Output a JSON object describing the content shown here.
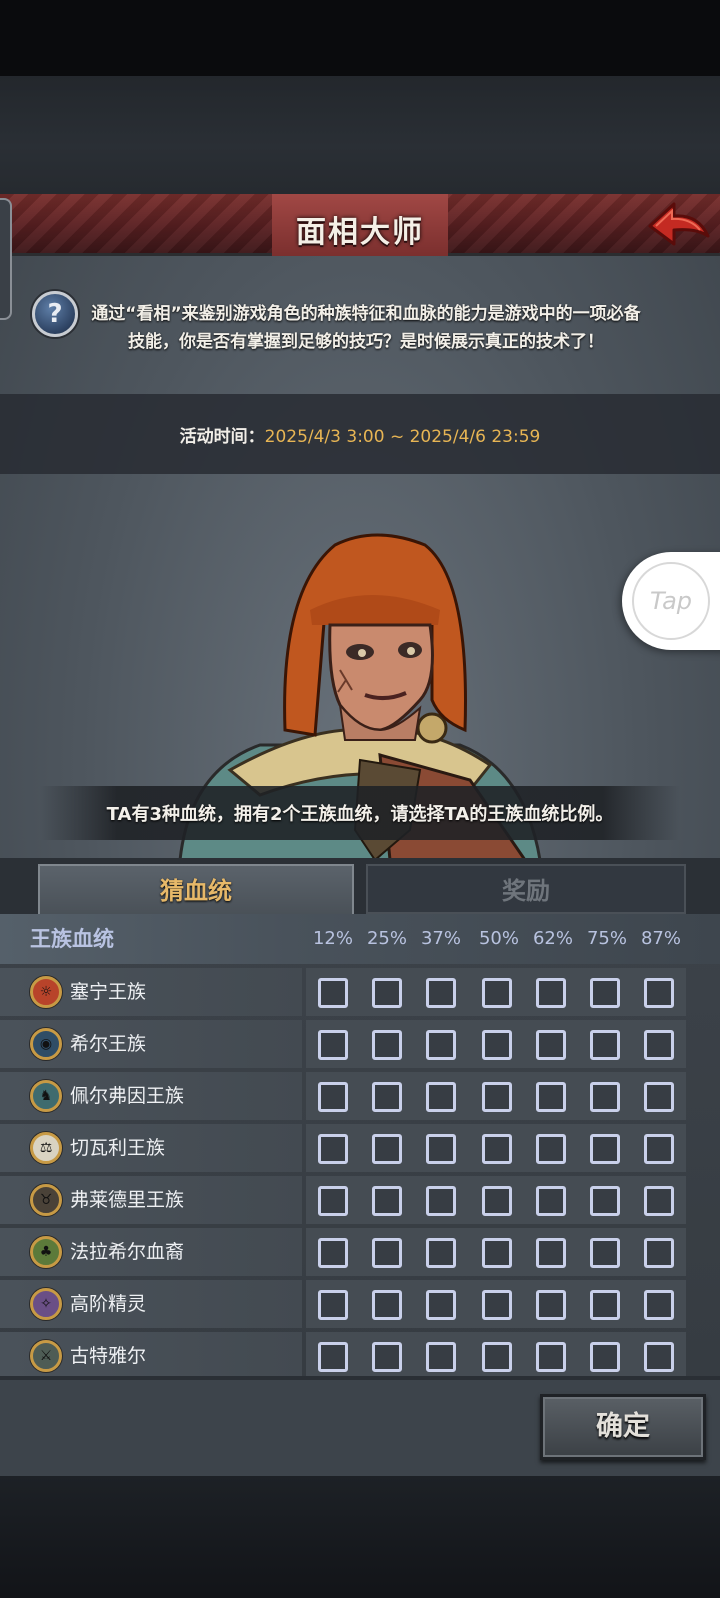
{
  "header": {
    "title": "面相大师"
  },
  "intro": {
    "text": "通过“看相”来鉴别游戏角色的种族特征和血脉的能力是游戏中的一项必备技能，你是否有掌握到足够的技巧？是时候展示真正的技术了！"
  },
  "event_time": {
    "label": "活动时间：",
    "value": "2025/4/3 3:00 ~ 2025/4/6 23:59"
  },
  "tap_button": {
    "label": "Tap"
  },
  "question": {
    "text": "TA有3种血统，拥有2个王族血统，请选择TA的王族血统比例。"
  },
  "tabs": [
    {
      "label": "猜血统",
      "active": true
    },
    {
      "label": "奖励",
      "active": false
    }
  ],
  "table": {
    "header_label": "王族血统",
    "percentages": [
      "12%",
      "25%",
      "37%",
      "50%",
      "62%",
      "75%",
      "87%"
    ],
    "rows": [
      {
        "name": "塞宁王族",
        "icon": "sun-crest-icon",
        "icon_color": "#b8432a",
        "glyph": "☼"
      },
      {
        "name": "希尔王族",
        "icon": "helmet-crest-icon",
        "icon_color": "#2f4d66",
        "glyph": "◉"
      },
      {
        "name": "佩尔弗因王族",
        "icon": "wolf-crest-icon",
        "icon_color": "#3f6b6e",
        "glyph": "♞"
      },
      {
        "name": "切瓦利王族",
        "icon": "scales-crest-icon",
        "icon_color": "#d9d3c2",
        "glyph": "⚖"
      },
      {
        "name": "弗莱德里王族",
        "icon": "bull-crest-icon",
        "icon_color": "#4a4238",
        "glyph": "♉"
      },
      {
        "name": "法拉希尔血裔",
        "icon": "tree-crest-icon",
        "icon_color": "#5c7a3a",
        "glyph": "♣"
      },
      {
        "name": "高阶精灵",
        "icon": "elf-crest-icon",
        "icon_color": "#6a4f86",
        "glyph": "✧"
      },
      {
        "name": "古特雅尔",
        "icon": "axe-crest-icon",
        "icon_color": "#4e5c55",
        "glyph": "⚔"
      }
    ]
  },
  "confirm_button": {
    "label": "确定"
  },
  "colors": {
    "accent_gold": "#e7b554",
    "title_red": "#7a2f2d",
    "checkbox": "#c9d0ea"
  }
}
